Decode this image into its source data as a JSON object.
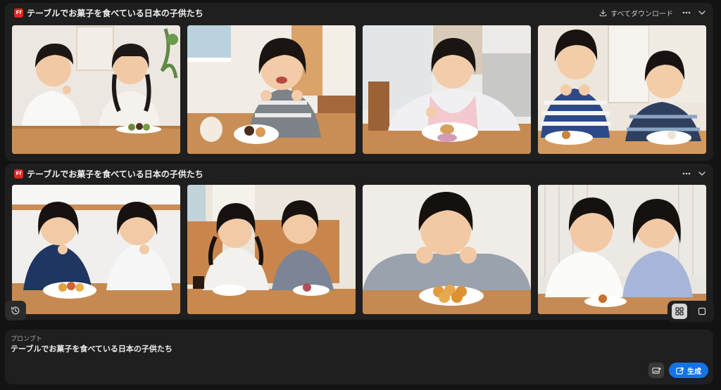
{
  "groups": [
    {
      "badge": "Ff",
      "title": "テーブルでお菓子を食べている日本の子供たち",
      "download_label": "すべてダウンロード",
      "more_icon": "ellipsis-icon",
      "collapse_icon": "chevron-down-icon"
    },
    {
      "badge": "Ff",
      "title": "テーブルでお菓子を食べている日本の子供たち",
      "more_icon": "ellipsis-icon",
      "collapse_icon": "chevron-down-icon"
    }
  ],
  "view_toggle": {
    "selected": "grid",
    "options": [
      "grid",
      "single"
    ]
  },
  "prompt": {
    "label": "プロンプト",
    "text": "テーブルでお菓子を食べている日本の子供たち"
  },
  "generate": {
    "label": "生成",
    "icon": "generate-icon"
  },
  "colors": {
    "accent": "#1473e6",
    "brand_badge": "#e5251c",
    "panel": "#1f1f1f",
    "background": "#131313"
  }
}
